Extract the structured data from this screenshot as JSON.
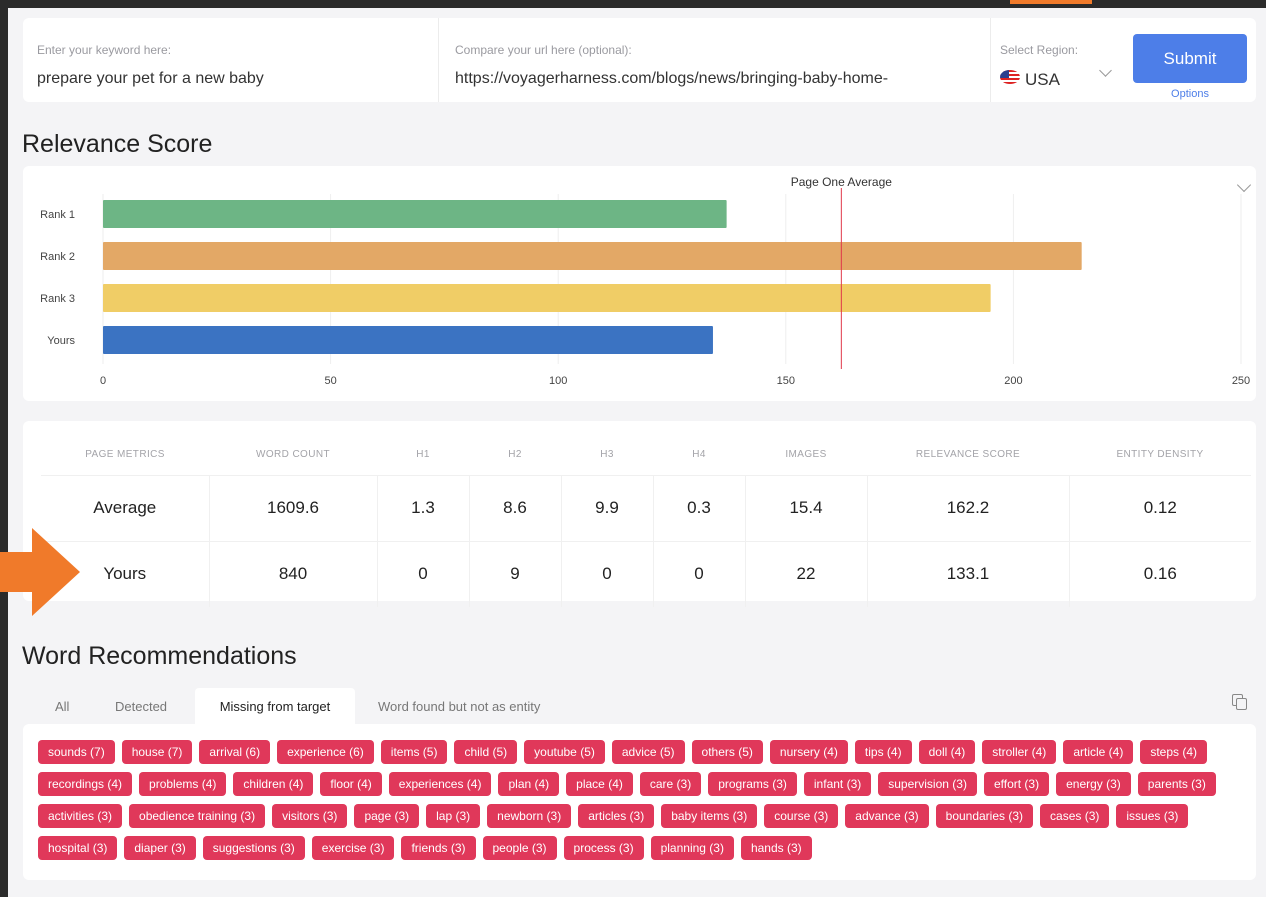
{
  "search": {
    "keyword_label": "Enter your keyword here:",
    "keyword_value": "prepare your pet for a new baby",
    "url_label": "Compare your url here (optional):",
    "url_value": "https://voyagerharness.com/blogs/news/bringing-baby-home-",
    "region_label": "Select Region:",
    "region_value": "USA",
    "submit_label": "Submit",
    "options_label": "Options"
  },
  "relevance": {
    "heading": "Relevance Score"
  },
  "chart_data": {
    "type": "bar",
    "orientation": "horizontal",
    "categories": [
      "Rank 1",
      "Rank 2",
      "Rank 3",
      "Yours"
    ],
    "values": [
      137,
      215,
      195,
      134
    ],
    "colors": [
      "#6db585",
      "#e3a866",
      "#f0cd66",
      "#3b73c2"
    ],
    "xlim": [
      0,
      250
    ],
    "xticks": [
      0,
      50,
      100,
      150,
      200,
      250
    ],
    "reference_line": {
      "label": "Page One Average",
      "value": 162.2,
      "color": "#e0384a"
    },
    "grid": true
  },
  "metrics": {
    "headers": [
      "PAGE METRICS",
      "WORD COUNT",
      "H1",
      "H2",
      "H3",
      "H4",
      "IMAGES",
      "RELEVANCE SCORE",
      "ENTITY DENSITY"
    ],
    "rows": [
      [
        "Average",
        "1609.6",
        "1.3",
        "8.6",
        "9.9",
        "0.3",
        "15.4",
        "162.2",
        "0.12"
      ],
      [
        "Yours",
        "840",
        "0",
        "9",
        "0",
        "0",
        "22",
        "133.1",
        "0.16"
      ]
    ]
  },
  "words": {
    "heading": "Word Recommendations",
    "tabs": [
      "All",
      "Detected",
      "Missing from target",
      "Word found but not as entity"
    ],
    "active_tab": "Missing from target",
    "chips": [
      "sounds (7)",
      "house (7)",
      "arrival (6)",
      "experience (6)",
      "items (5)",
      "child (5)",
      "youtube (5)",
      "advice (5)",
      "others (5)",
      "nursery (4)",
      "tips (4)",
      "doll (4)",
      "stroller (4)",
      "article (4)",
      "steps (4)",
      "recordings (4)",
      "problems (4)",
      "children (4)",
      "floor (4)",
      "experiences (4)",
      "plan (4)",
      "place (4)",
      "care (3)",
      "programs (3)",
      "infant (3)",
      "supervision (3)",
      "effort (3)",
      "energy (3)",
      "parents (3)",
      "activities (3)",
      "obedience training (3)",
      "visitors (3)",
      "page (3)",
      "lap (3)",
      "newborn (3)",
      "articles (3)",
      "baby items (3)",
      "course (3)",
      "advance (3)",
      "boundaries (3)",
      "cases (3)",
      "issues (3)",
      "hospital (3)",
      "diaper (3)",
      "suggestions (3)",
      "exercise (3)",
      "friends (3)",
      "people (3)",
      "process (3)",
      "planning (3)",
      "hands (3)"
    ]
  }
}
